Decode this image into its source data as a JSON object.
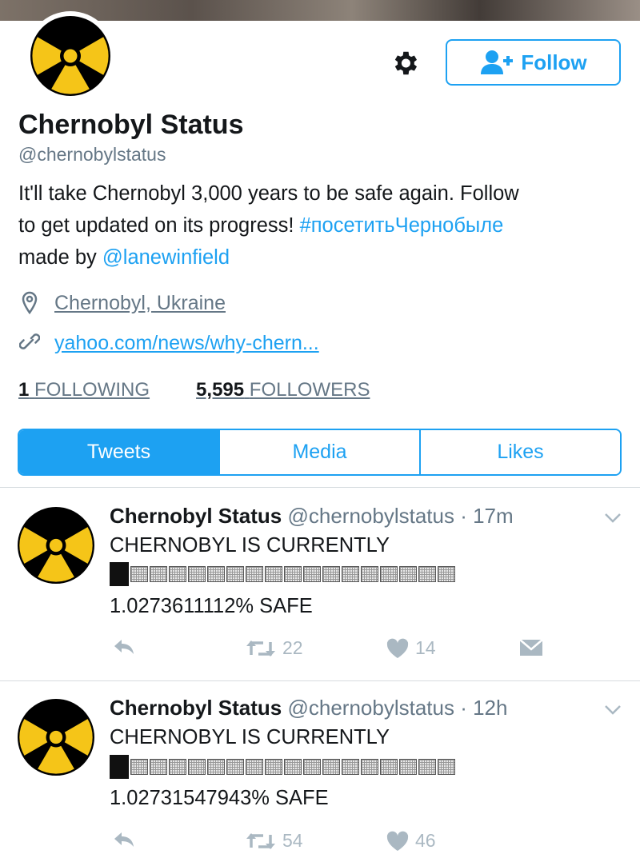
{
  "profile": {
    "name": "Chernobyl Status",
    "handle": "@chernobylstatus",
    "bio": {
      "line1": "It'll take Chernobyl 3,000 years to be safe again. Follow",
      "line2_text": "to get updated on its progress! ",
      "hashtag": "#посетитьЧернобыле",
      "line3_text": "made by ",
      "mention": "@lanewinfield"
    },
    "location": "Chernobyl, Ukraine",
    "website": "yahoo.com/news/why-chern...",
    "following_count": "1",
    "following_label": "FOLLOWING",
    "followers_count": "5,595",
    "followers_label": "FOLLOWERS"
  },
  "follow_button": {
    "label": "Follow"
  },
  "tabs": [
    {
      "label": "Tweets"
    },
    {
      "label": "Media"
    },
    {
      "label": "Likes"
    }
  ],
  "tweets": [
    {
      "name": "Chernobyl Status",
      "handle": "@chernobylstatus",
      "time": "· 17m",
      "line1": "CHERNOBYL IS CURRENTLY",
      "progress_fraction": 0.0102,
      "line2": "1.0273611112% SAFE",
      "retweets": "22",
      "likes": "14"
    },
    {
      "name": "Chernobyl Status",
      "handle": "@chernobylstatus",
      "time": "· 12h",
      "line1": "CHERNOBYL IS CURRENTLY",
      "progress_fraction": 0.0102,
      "line2": "1.02731547943% SAFE",
      "retweets": "54",
      "likes": "46"
    }
  ],
  "colors": {
    "accent": "#1da1f2",
    "muted": "#657786",
    "icon_muted": "#aab8c2",
    "text": "#14171a"
  },
  "icons": [
    "radiation-icon",
    "gear-icon",
    "add-user-icon",
    "location-pin-icon",
    "link-icon",
    "chevron-down-icon",
    "reply-icon",
    "retweet-icon",
    "heart-icon",
    "direct-message-icon"
  ]
}
